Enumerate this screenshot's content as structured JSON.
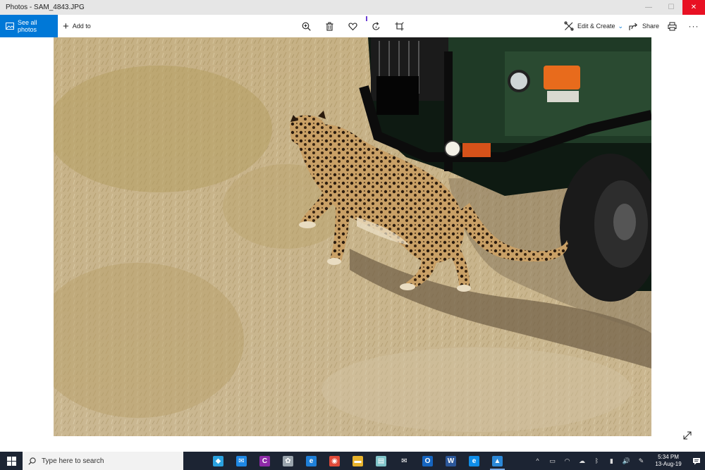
{
  "window": {
    "title": "Photos - SAM_4843.JPG",
    "controls": {
      "minimize": "—",
      "maximize": "☐",
      "close": "✕"
    }
  },
  "toolbar": {
    "see_all_photos": "See all photos",
    "add_to": "Add to",
    "add_plus": "+",
    "edit_create": "Edit & Create",
    "edit_chevron": "⌄",
    "share": "Share",
    "more": "···"
  },
  "taskbar": {
    "search_placeholder": "Type here to search",
    "clock_time": "5:34 PM",
    "clock_date": "13-Aug-19",
    "pinned": [
      {
        "name": "task-view",
        "glyph": "",
        "color": "#1c2433"
      },
      {
        "name": "app-diamond",
        "glyph": "◆",
        "color": "#2aa2e0"
      },
      {
        "name": "app-messenger",
        "glyph": "✉",
        "color": "#1e88e5"
      },
      {
        "name": "app-c",
        "glyph": "C",
        "color": "#8e2aa8"
      },
      {
        "name": "app-wheel",
        "glyph": "✿",
        "color": "#9aa4ad"
      },
      {
        "name": "edge-legacy",
        "glyph": "e",
        "color": "#1e7fd8"
      },
      {
        "name": "chrome",
        "glyph": "◉",
        "color": "#e04a3a"
      },
      {
        "name": "file-explorer",
        "glyph": "▬",
        "color": "#e8b32c"
      },
      {
        "name": "app-book",
        "glyph": "▤",
        "color": "#7fc3c9"
      },
      {
        "name": "mail",
        "glyph": "✉",
        "color": "#1c2433"
      },
      {
        "name": "outlook",
        "glyph": "O",
        "color": "#1565c0"
      },
      {
        "name": "word",
        "glyph": "W",
        "color": "#2b579a"
      },
      {
        "name": "edge",
        "glyph": "e",
        "color": "#0f8de8"
      },
      {
        "name": "photos",
        "glyph": "▲",
        "color": "#2b88d8"
      }
    ],
    "tray": [
      "^",
      "▭",
      "◠",
      "☁",
      "ᛒ",
      "▮",
      "🔊",
      "✎"
    ]
  },
  "colors": {
    "accent": "#0078d7",
    "taskbar": "#1c2433",
    "close": "#e81123",
    "rotate_marker": "#6b3fd4"
  }
}
